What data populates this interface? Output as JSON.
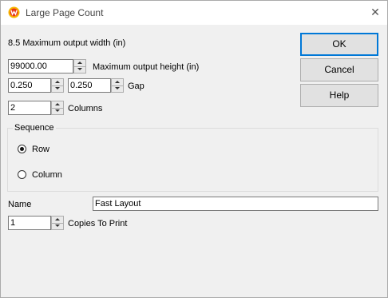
{
  "window": {
    "title": "Large Page Count",
    "close_icon": "close-icon",
    "app_icon": "app-logo-icon"
  },
  "form": {
    "max_width_label": "8.5 Maximum output width (in)",
    "max_height": {
      "value": "99000.00",
      "label": "Maximum output height (in)"
    },
    "gap": {
      "value1": "0.250",
      "value2": "0.250",
      "label": "Gap"
    },
    "columns": {
      "value": "2",
      "label": "Columns"
    },
    "sequence": {
      "title": "Sequence",
      "options": [
        {
          "label": "Row",
          "selected": true
        },
        {
          "label": "Column",
          "selected": false
        }
      ]
    },
    "name": {
      "label": "Name",
      "value": "Fast Layout"
    },
    "copies": {
      "value": "1",
      "label": "Copies To Print"
    }
  },
  "buttons": {
    "ok": "OK",
    "cancel": "Cancel",
    "help": "Help"
  },
  "colors": {
    "default_button_border": "#0078d7",
    "dialog_bg": "#f0f0f0"
  }
}
